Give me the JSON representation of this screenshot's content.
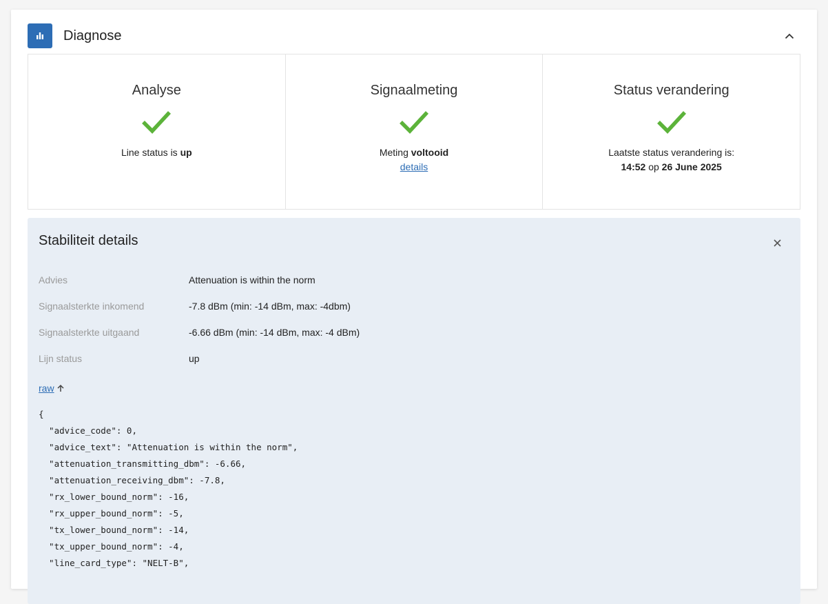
{
  "header": {
    "title": "Diagnose",
    "icon": "bar-chart-icon",
    "accent_color": "#2d6db5"
  },
  "tiles": [
    {
      "title": "Analyse",
      "icon": "checkmark-icon",
      "text_prefix": "Line status is ",
      "text_bold": "up"
    },
    {
      "title": "Signaalmeting",
      "icon": "checkmark-icon",
      "text_prefix": "Meting ",
      "text_bold": "voltooid",
      "link": "details"
    },
    {
      "title": "Status verandering",
      "icon": "checkmark-icon",
      "text_line1": "Laatste status verandering is:",
      "time": "14:52",
      "op": " op ",
      "date": "26 June 2025"
    }
  ],
  "check_color": "#5cb33a",
  "details": {
    "title": "Stabiliteit details",
    "rows": [
      {
        "label": "Advies",
        "value": "Attenuation is within the norm"
      },
      {
        "label": "Signaalsterkte inkomend",
        "value": "-7.8 dBm (min: -14 dBm, max: -4dbm)"
      },
      {
        "label": "Signaalsterkte uitgaand",
        "value": "-6.66 dBm (min: -14 dBm, max: -4 dBm)"
      },
      {
        "label": "Lijn status",
        "value": "up"
      }
    ],
    "raw_label": "raw",
    "raw_lines": [
      "{",
      "  \"advice_code\": 0,",
      "  \"advice_text\": \"Attenuation is within the norm\",",
      "  \"attenuation_transmitting_dbm\": -6.66,",
      "  \"attenuation_receiving_dbm\": -7.8,",
      "  \"rx_lower_bound_norm\": -16,",
      "  \"rx_upper_bound_norm\": -5,",
      "  \"tx_lower_bound_norm\": -14,",
      "  \"tx_upper_bound_norm\": -4,",
      "  \"line_card_type\": \"NELT-B\","
    ]
  }
}
